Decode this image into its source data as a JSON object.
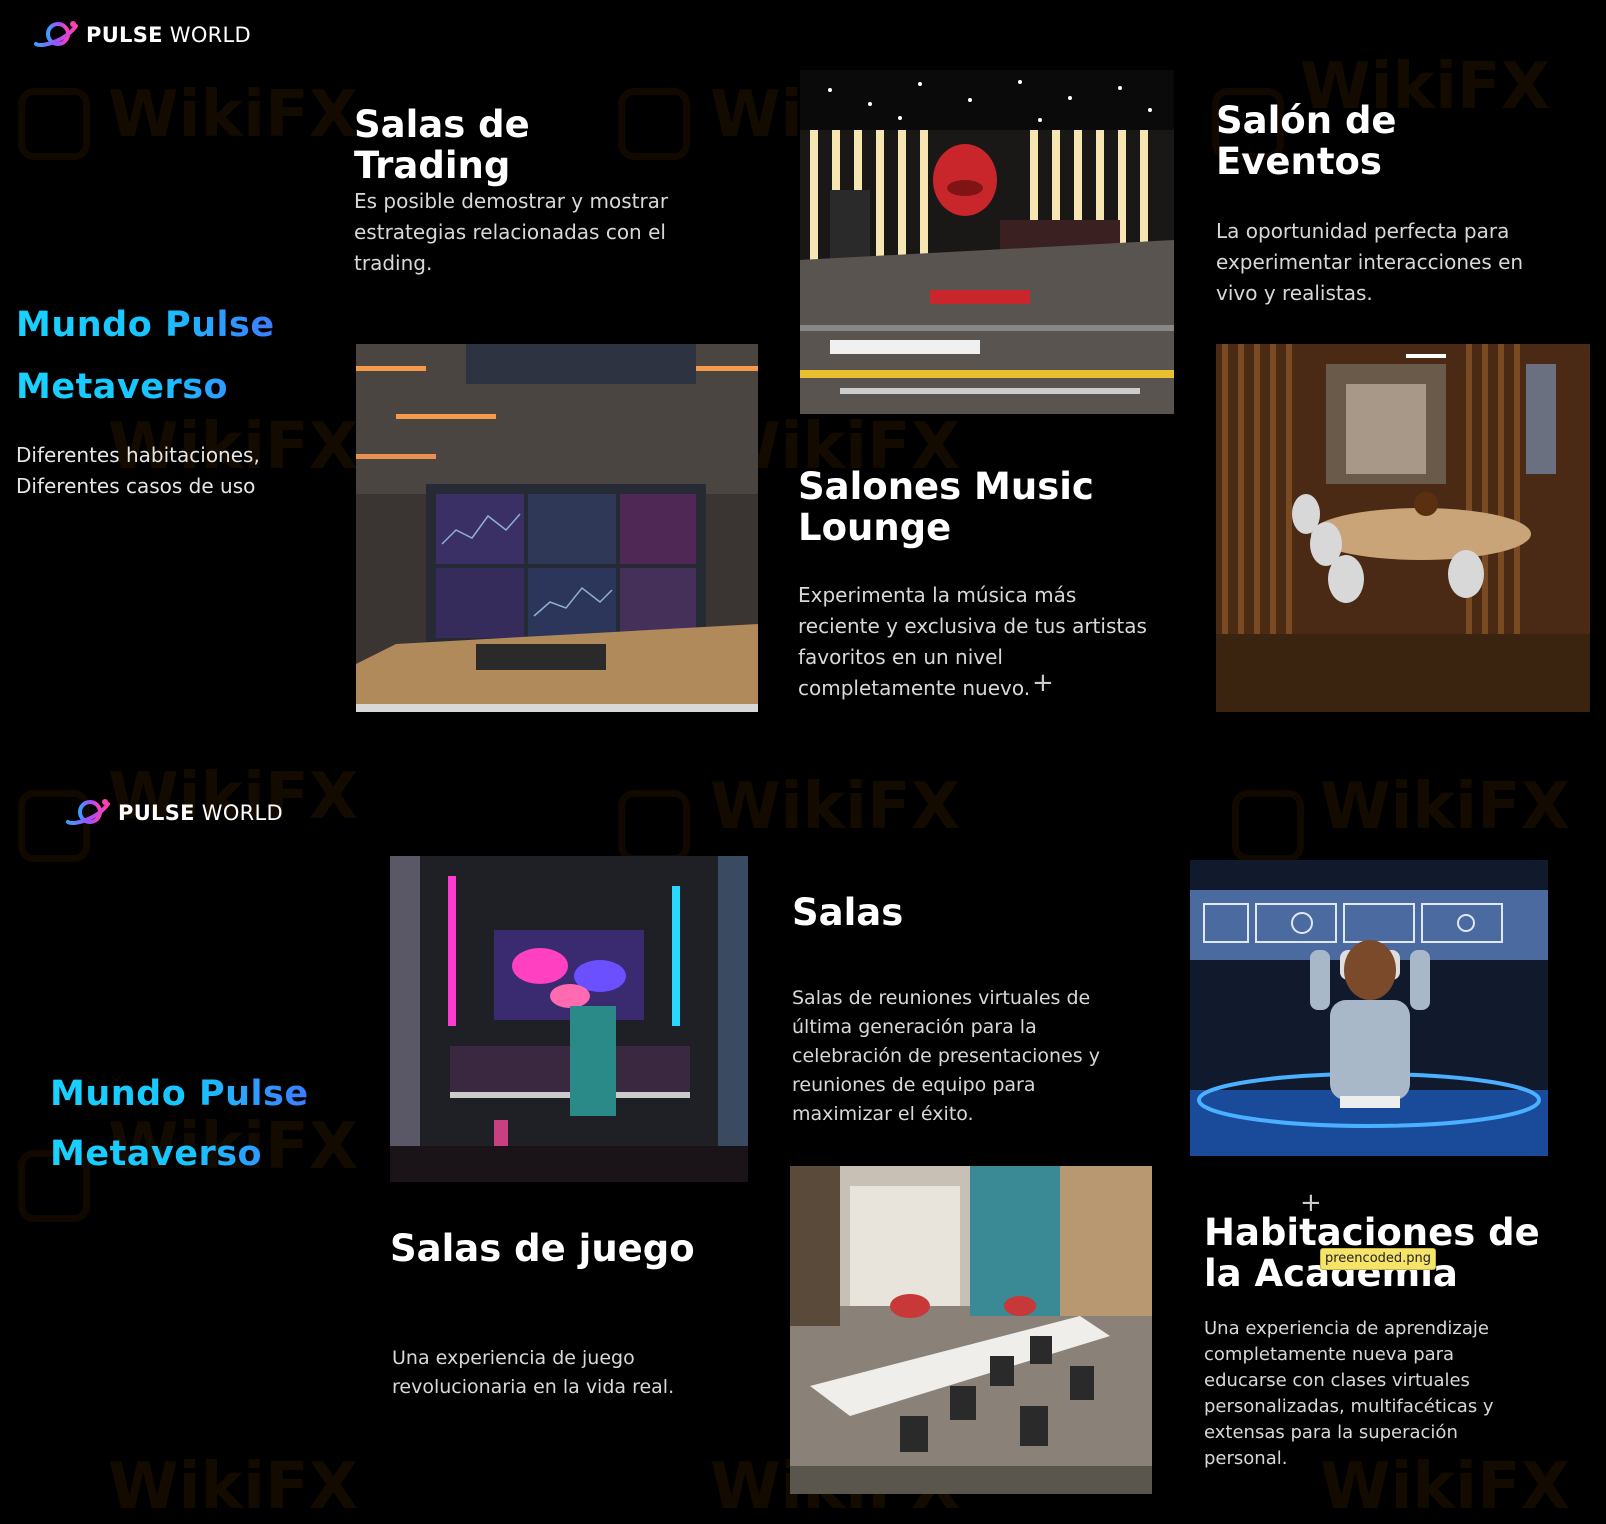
{
  "brand": {
    "name_bold": "PULSE",
    "name_light": " WORLD",
    "colors": {
      "cyan": "#18d2ff",
      "blue": "#3d7cff",
      "magenta": "#e048d8",
      "background": "#000000"
    }
  },
  "watermark": {
    "text": "WikiFX"
  },
  "top": {
    "side_title_line1": "Mundo Pulse",
    "side_title_line2": "Metaverso",
    "side_sub_line1": "Diferentes habitaciones,",
    "side_sub_line2": "Diferentes casos de uso",
    "trading": {
      "title_line1": "Salas de",
      "title_line2": "Trading",
      "desc_line1": "Es posible demostrar y mostrar",
      "desc_line2": "estrategias relacionadas con el",
      "desc_line3": "trading."
    },
    "music": {
      "title_line1": "Salones Music",
      "title_line2": "Lounge",
      "desc_line1": "Experimenta la música más",
      "desc_line2": "reciente y exclusiva de tus artistas",
      "desc_line3": "favoritos en un nivel",
      "desc_line4": "completamente nuevo."
    },
    "events": {
      "title_line1": "Salón de",
      "title_line2": "Eventos",
      "desc_line1": "La oportunidad perfecta para",
      "desc_line2": "experimentar interacciones en",
      "desc_line3": "vivo y realistas."
    }
  },
  "bottom": {
    "side_title_line1": "Mundo Pulse",
    "side_title_line2": "Metaverso",
    "gaming": {
      "title": "Salas de juego",
      "desc_line1": "Una experiencia de juego",
      "desc_line2": "revolucionaria en la vida real."
    },
    "rooms": {
      "title": "Salas",
      "desc_line1": "Salas de reuniones virtuales de",
      "desc_line2": "última generación para la",
      "desc_line3": "celebración de presentaciones y",
      "desc_line4": "reuniones de equipo para",
      "desc_line5": "maximizar el éxito."
    },
    "academy": {
      "title_line1": "Habitaciones de",
      "title_line2": "la Academia",
      "desc_line1": "Una experiencia de aprendizaje",
      "desc_line2": "completamente nueva para",
      "desc_line3": "educarse con clases virtuales",
      "desc_line4": "personalizadas, multifacéticas y",
      "desc_line5": "extensas para la superación",
      "desc_line6": "personal."
    },
    "tooltip": "preencoded.png"
  }
}
